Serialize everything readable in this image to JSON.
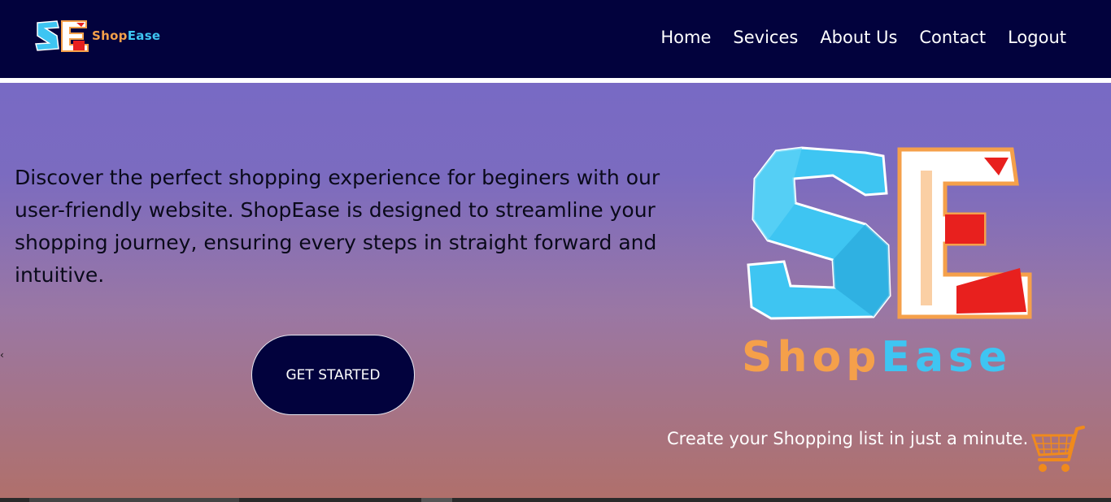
{
  "nav": {
    "brand_part1": "Shop",
    "brand_part2": "Ease",
    "logo_letters": "SE",
    "links": [
      "Home",
      "Sevices",
      "About Us",
      "Contact",
      "Logout"
    ]
  },
  "hero": {
    "description": "Discover the perfect shopping experience for beginers with our user-friendly website. ShopEase is designed to streamline your shopping journey, ensuring every steps in straight forward and intuitive.",
    "cta_label": "GET STARTED",
    "brand_part1": "Shop",
    "brand_part2": "Ease",
    "tagline": "Create your Shopping list in just a minute.",
    "stray_char": "‹"
  },
  "colors": {
    "nav_bg": "#02023d",
    "hero_top": "#786ac4",
    "hero_bottom": "#b0706b",
    "brand_orange": "#f5a04a",
    "brand_blue": "#3ec5f2",
    "logo_red": "#e8201e"
  },
  "icons": [
    "shopease-logo-icon",
    "shopping-cart-icon"
  ]
}
